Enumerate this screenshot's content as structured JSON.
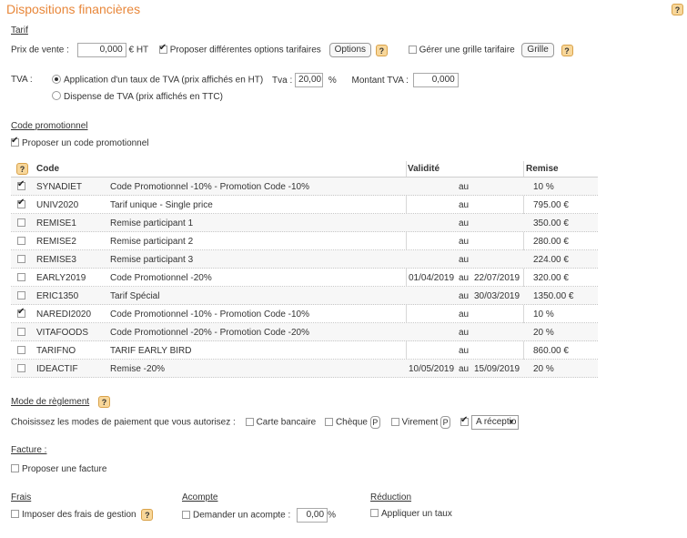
{
  "page": {
    "title": "Dispositions financières",
    "help": "?"
  },
  "tarif": {
    "heading": "Tarif",
    "price_label": "Prix de vente :",
    "price_value": "0,000",
    "price_unit": "€ HT",
    "options_label": "Proposer différentes options tarifaires",
    "options_button": "Options",
    "grid_label": "Gérer une grille tarifaire",
    "grid_button": "Grille",
    "help": "?"
  },
  "tva": {
    "label": "TVA :",
    "option_apply": "Application d'un taux de TVA (prix affichés en HT)",
    "rate_label": "Tva :",
    "rate_value": "20,00",
    "rate_unit": "%",
    "amount_label": "Montant TVA :",
    "amount_value": "0,000",
    "option_exempt": "Dispense de TVA (prix affichés en TTC)"
  },
  "promo": {
    "heading": "Code promotionnel",
    "offer_label": "Proposer un code promotionnel",
    "help": "?",
    "columns": {
      "code": "Code",
      "validity": "Validité",
      "remise": "Remise"
    },
    "rows": [
      {
        "checked": true,
        "code": "SYNADIET",
        "desc": "Code Promotionnel -10% - Promotion Code -10%",
        "from": "",
        "au": "au",
        "to": "",
        "remise": "10 %"
      },
      {
        "checked": true,
        "code": "UNIV2020",
        "desc": "Tarif unique - Single price",
        "from": "",
        "au": "au",
        "to": "",
        "remise": "795.00 €"
      },
      {
        "checked": false,
        "code": "REMISE1",
        "desc": "Remise participant 1",
        "from": "",
        "au": "au",
        "to": "",
        "remise": "350.00 €"
      },
      {
        "checked": false,
        "code": "REMISE2",
        "desc": "Remise participant 2",
        "from": "",
        "au": "au",
        "to": "",
        "remise": "280.00 €"
      },
      {
        "checked": false,
        "code": "REMISE3",
        "desc": "Remise participant 3",
        "from": "",
        "au": "au",
        "to": "",
        "remise": "224.00 €"
      },
      {
        "checked": false,
        "code": "EARLY2019",
        "desc": "Code Promotionnel -20%",
        "from": "01/04/2019",
        "au": "au",
        "to": "22/07/2019",
        "remise": "320.00 €"
      },
      {
        "checked": false,
        "code": "ERIC1350",
        "desc": "Tarif Spécial",
        "from": "",
        "au": "au",
        "to": "30/03/2019",
        "remise": "1350.00 €"
      },
      {
        "checked": true,
        "code": "NAREDI2020",
        "desc": "Code Promotionnel -10% - Promotion Code -10%",
        "from": "",
        "au": "au",
        "to": "",
        "remise": "10 %"
      },
      {
        "checked": false,
        "code": "VITAFOODS",
        "desc": "Code Promotionnel -20% - Promotion Code -20%",
        "from": "",
        "au": "au",
        "to": "",
        "remise": "20 %"
      },
      {
        "checked": false,
        "code": "TARIFNO",
        "desc": "TARIF EARLY BIRD",
        "from": "",
        "au": "au",
        "to": "",
        "remise": "860.00 €"
      },
      {
        "checked": false,
        "code": "IDEACTIF",
        "desc": "Remise -20%",
        "from": "10/05/2019",
        "au": "au",
        "to": "15/09/2019",
        "remise": "20 %"
      }
    ]
  },
  "reglement": {
    "heading": "Mode de règlement",
    "help": "?",
    "prompt": "Choisissez les modes de paiement que vous autorisez :",
    "card": "Carte bancaire",
    "cheque": "Chèque",
    "cheque_badge": "P",
    "virement": "Virement",
    "virement_badge": "P",
    "reception": "A réceptio",
    "reception_arrow": "▼"
  },
  "facture": {
    "heading": "Facture :",
    "offer": "Proposer une facture"
  },
  "frais": {
    "heading": "Frais",
    "label": "Imposer des frais de gestion",
    "help": "?"
  },
  "acompte": {
    "heading": "Acompte",
    "label": "Demander un acompte  :",
    "value": "0,00",
    "unit": "%"
  },
  "reduction": {
    "heading": "Réduction",
    "label": "Appliquer un taux"
  }
}
